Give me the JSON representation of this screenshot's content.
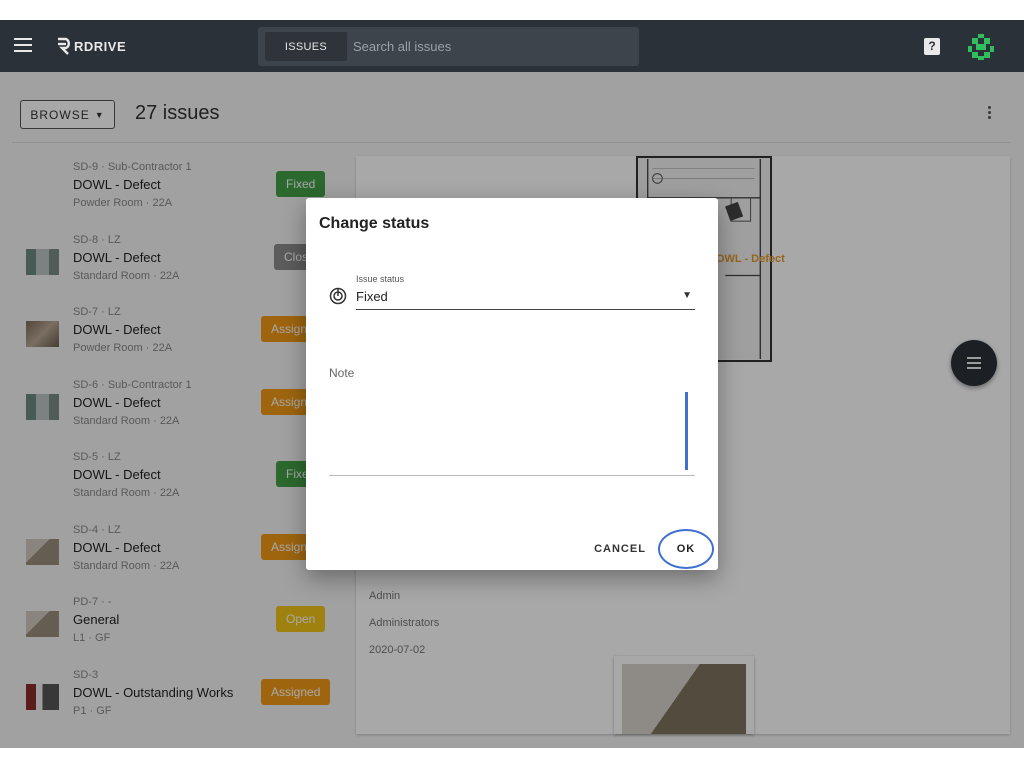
{
  "app": {
    "logo_text": "RDRIVE"
  },
  "search": {
    "scope_label": "ISSUES",
    "placeholder": "Search all issues"
  },
  "topbar": {
    "help_label": "?"
  },
  "toolbar": {
    "browse_label": "BROWSE",
    "issue_count": "27 issues"
  },
  "issues": [
    {
      "meta": "SD-9 · Sub-Contractor 1",
      "title": "DOWL - Defect",
      "location": "Powder Room · 22A",
      "status": "Fixed",
      "status_color": "#43a047",
      "thumb": "none"
    },
    {
      "meta": "SD-8 · LZ",
      "title": "DOWL - Defect",
      "location": "Standard Room · 22A",
      "status": "Closed",
      "status_color": "#8c8c8c",
      "thumb": "t2"
    },
    {
      "meta": "SD-7 · LZ",
      "title": "DOWL - Defect",
      "location": "Powder Room · 22A",
      "status": "Assigned",
      "status_color": "#f09a16",
      "thumb": "t3"
    },
    {
      "meta": "SD-6 · Sub-Contractor 1",
      "title": "DOWL - Defect",
      "location": "Standard Room · 22A",
      "status": "Assigned",
      "status_color": "#f09a16",
      "thumb": "t2"
    },
    {
      "meta": "SD-5 · LZ",
      "title": "DOWL - Defect",
      "location": "Standard Room · 22A",
      "status": "Fixed",
      "status_color": "#43a047",
      "thumb": "none"
    },
    {
      "meta": "SD-4 · LZ",
      "title": "DOWL - Defect",
      "location": "Standard Room · 22A",
      "status": "Assigned",
      "status_color": "#f09a16",
      "thumb": "t4"
    },
    {
      "meta": "PD-7 · -",
      "title": "General",
      "location": "L1 · GF",
      "status": "Open",
      "status_color": "#f2c417",
      "thumb": "t4"
    },
    {
      "meta": "SD-3",
      "title": "DOWL - Outstanding Works",
      "location": "P1 · GF",
      "status": "Assigned",
      "status_color": "#f09a16",
      "thumb": "t5"
    }
  ],
  "detail": {
    "plan_label": "DOWL - Defect",
    "created_by": "Admin",
    "group": "Administrators",
    "date": "2020-07-02"
  },
  "dialog": {
    "title": "Change status",
    "status_field_label": "Issue status",
    "status_value": "Fixed",
    "note_label": "Note",
    "note_value": "",
    "cancel_label": "CANCEL",
    "ok_label": "OK"
  }
}
